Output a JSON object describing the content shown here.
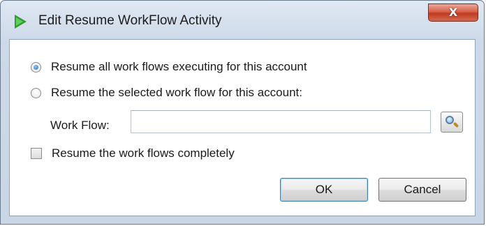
{
  "dialog": {
    "title": "Edit Resume WorkFlow Activity",
    "close_label": "X",
    "options": {
      "resume_all_label": "Resume all work flows executing for this account",
      "resume_all_selected": true,
      "resume_selected_label": "Resume the selected work flow for this account:",
      "resume_selected_selected": false
    },
    "workflow": {
      "label": "Work Flow:",
      "value": "",
      "placeholder": ""
    },
    "resume_completely": {
      "label": "Resume the work flows completely",
      "checked": false
    },
    "buttons": {
      "ok_label": "OK",
      "cancel_label": "Cancel"
    }
  },
  "icons": {
    "app": "play-triangle-icon",
    "search": "magnifier-icon"
  },
  "colors": {
    "titlebar": "#cdd9e8",
    "close": "#c23b22",
    "radio_accent": "#2a6fb5",
    "app_icon": "#2f9e2f"
  }
}
